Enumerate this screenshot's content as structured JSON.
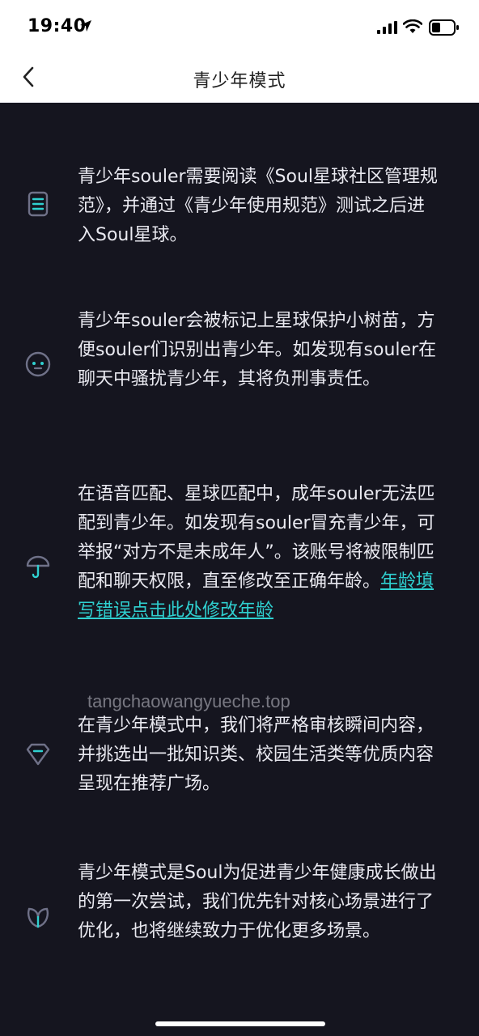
{
  "status_bar": {
    "time": "19:40",
    "icons": [
      "location-arrow-icon",
      "signal-icon",
      "wifi-icon",
      "battery-icon"
    ]
  },
  "header": {
    "title": "青少年模式",
    "back_icon": "chevron-left-icon"
  },
  "sections": [
    {
      "icon": "document-icon",
      "text": "青少年souler需要阅读《Soul星球社区管理规范》，并通过《青少年使用规范》测试之后进入Soul星球。"
    },
    {
      "icon": "face-icon",
      "text": "青少年souler会被标记上星球保护小树苗，方便souler们识别出青少年。如发现有souler在聊天中骚扰青少年，其将负刑事责任。"
    },
    {
      "icon": "umbrella-icon",
      "text": "在语音匹配、星球匹配中，成年souler无法匹配到青少年。如发现有souler冒充青少年，可举报“对方不是未成年人”。该账号将被限制匹配和聊天权限，直至修改至正确年龄。",
      "link": "年龄填写错误点击此处修改年龄"
    },
    {
      "icon": "diamond-icon",
      "text": "在青少年模式中，我们将严格审核瞬间内容，并挑选出一批知识类、校园生活类等优质内容呈现在推荐广场。"
    },
    {
      "icon": "leaf-icon",
      "text": "青少年模式是Soul为促进青少年健康成长做出的第一次尝试，我们优先针对核心场景进行了优化，也将继续致力于优化更多场景。"
    }
  ],
  "watermark": "tangchaowangyueche.top",
  "colors": {
    "background": "#15151f",
    "text": "#e9e9f0",
    "accent": "#2fd0d0",
    "icon_stroke": "#6f7188"
  }
}
